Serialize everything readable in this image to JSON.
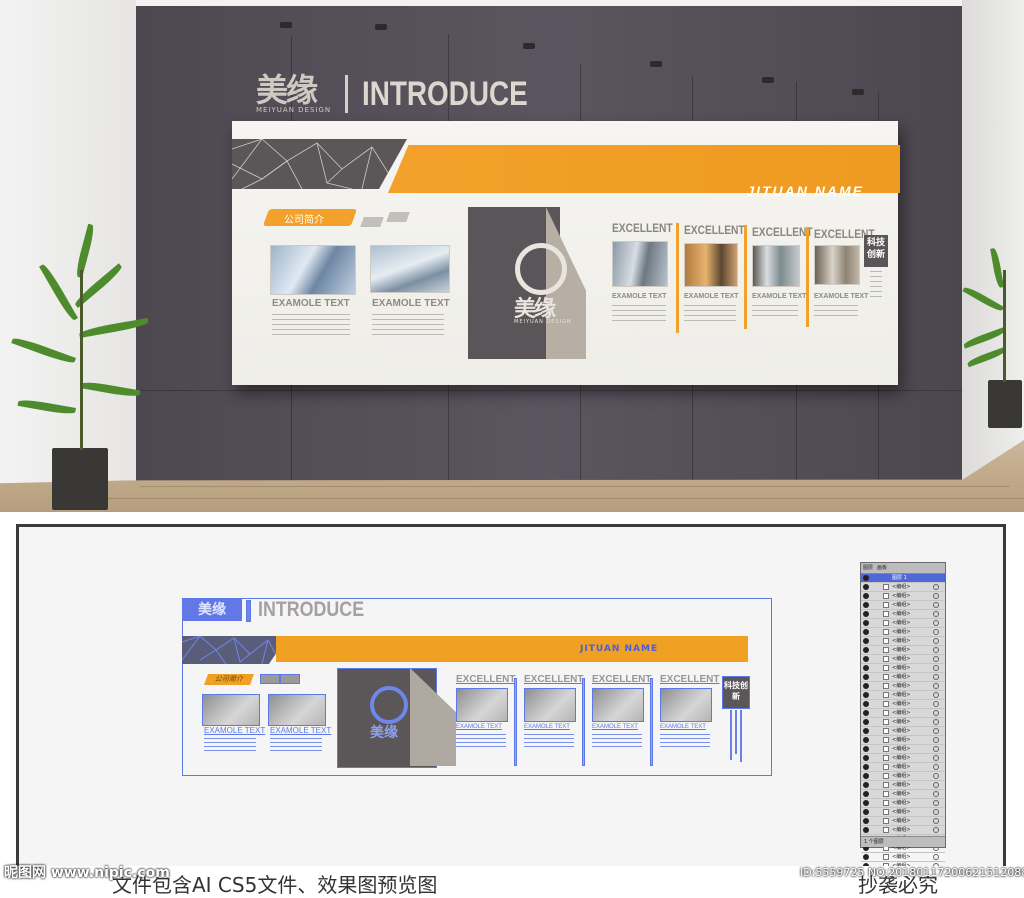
{
  "render": {
    "brand_logo": "美缘",
    "brand_sub": "MEIYUAN DESIGN",
    "headline_title": "INTRODUCE",
    "band_title": "JITUAN NAME",
    "intro_tag": "公司简介",
    "left_captions": [
      "EXAMOLE TEXT",
      "EXAMOLE TEXT"
    ],
    "center_logo": "美缘",
    "center_logo_sub": "MEIYUAN DESIGN",
    "excellent_titles": [
      "EXCELLENT",
      "EXCELLENT",
      "EXCELLENT",
      "EXCELLENT"
    ],
    "excellent_captions": [
      "EXAMOLE TEXT",
      "EXAMOLE TEXT",
      "EXAMOLE TEXT",
      "EXAMOLE TEXT"
    ],
    "tech_badge": "科技创新",
    "colors": {
      "accent": "#f2a12a",
      "wall": "#57525a",
      "panel": "#5a5558"
    }
  },
  "preview": {
    "headline_title": "INTRODUCE",
    "intro_tag": "公司简介",
    "left_captions": [
      "EXAMOLE TEXT",
      "EXAMOLE TEXT"
    ],
    "excellent_titles": [
      "EXCELLENT",
      "EXCELLENT",
      "EXCELLENT",
      "EXCELLENT"
    ],
    "excellent_captions": [
      "EXAMOLE TEXT",
      "EXAMOLE TEXT",
      "EXAMOLE TEXT",
      "EXAMOLE TEXT"
    ],
    "tech_badge": "科技创新",
    "selection_color": "#5d79e8"
  },
  "layers_panel": {
    "tabs": [
      "图层",
      "画板"
    ],
    "top_layer": "图层 1",
    "sub_layer": "<编组>",
    "footer": "1 个图层"
  },
  "footer": {
    "caption": "文件包含AI CS5文件、效果图预览图",
    "right_caption": "抄袭必究",
    "watermark_left": "昵图网 www.nipic.com",
    "watermark_right": "ID:5559725 NO:20180117200621512088"
  }
}
